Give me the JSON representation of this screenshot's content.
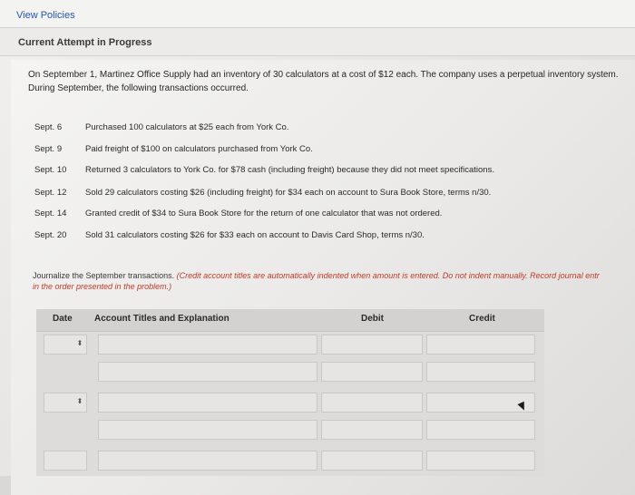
{
  "header": {
    "view_policies": "View Policies"
  },
  "attempt": {
    "status": "Current Attempt in Progress"
  },
  "problem": {
    "intro": "On September 1, Martinez Office Supply had an inventory of 30 calculators at a cost of $12 each. The company uses a perpetual inventory system. During September, the following transactions occurred.",
    "transactions": [
      {
        "date": "Sept. 6",
        "desc": "Purchased 100 calculators at $25 each from York Co."
      },
      {
        "date": "Sept. 9",
        "desc": "Paid freight of $100 on calculators purchased from York Co."
      },
      {
        "date": "Sept. 10",
        "desc": "Returned 3 calculators to York Co. for $78 cash (including freight) because they did not meet specifications."
      },
      {
        "date": "Sept. 12",
        "desc": "Sold 29 calculators costing $26 (including freight) for $34 each on account to Sura Book Store, terms n/30."
      },
      {
        "date": "Sept. 14",
        "desc": "Granted credit of $34 to Sura Book Store for the return of one calculator that was not ordered."
      },
      {
        "date": "Sept. 20",
        "desc": "Sold 31 calculators costing $26 for $33 each on account to Davis Card Shop, terms n/30."
      }
    ],
    "instruction_lead": "Journalize the September transactions.",
    "instruction_note": "(Credit account titles are automatically indented when amount is entered. Do not indent manually. Record journal entr",
    "instruction_note2": "in the order presented in the problem.)"
  },
  "journal": {
    "columns": {
      "date": "Date",
      "account": "Account Titles and Explanation",
      "debit": "Debit",
      "credit": "Credit"
    },
    "spinner_glyph": "⬍"
  }
}
